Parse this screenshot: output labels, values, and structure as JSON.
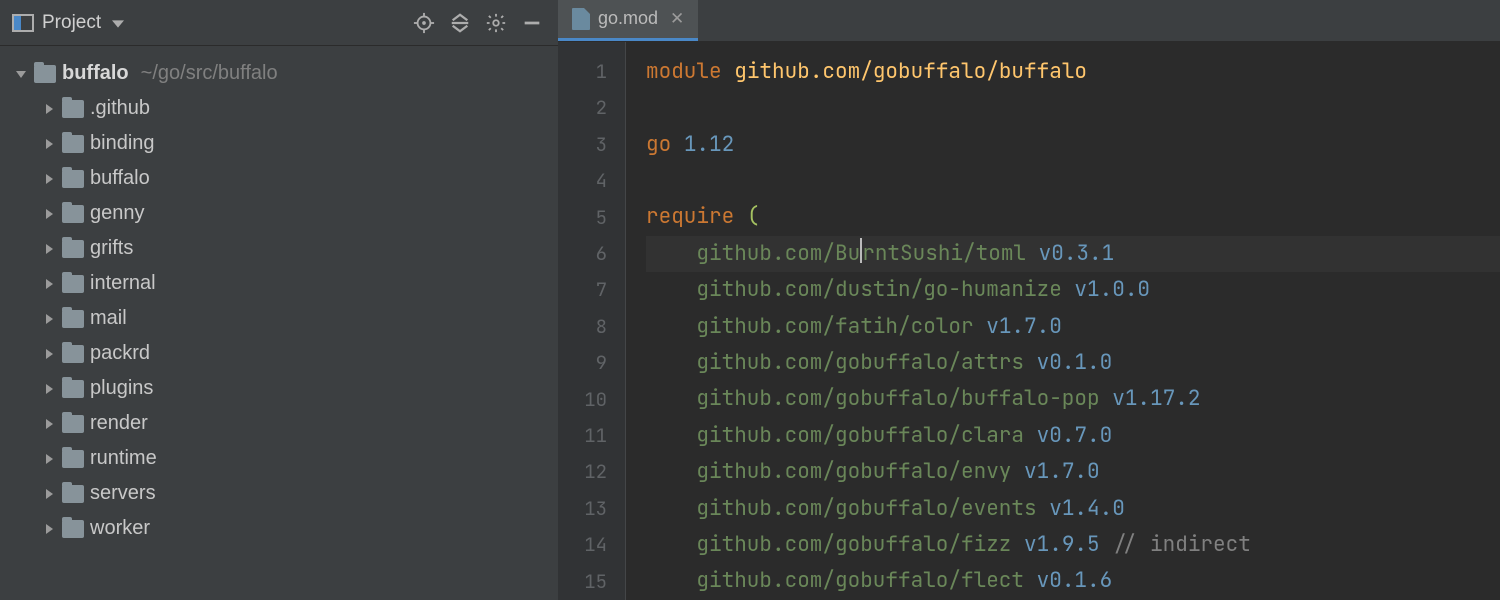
{
  "sidebar": {
    "panel_label": "Project",
    "root": {
      "name": "buffalo",
      "path": "~/go/src/buffalo"
    },
    "children": [
      {
        "name": ".github"
      },
      {
        "name": "binding"
      },
      {
        "name": "buffalo"
      },
      {
        "name": "genny"
      },
      {
        "name": "grifts"
      },
      {
        "name": "internal"
      },
      {
        "name": "mail"
      },
      {
        "name": "packrd"
      },
      {
        "name": "plugins"
      },
      {
        "name": "render"
      },
      {
        "name": "runtime"
      },
      {
        "name": "servers"
      },
      {
        "name": "worker"
      }
    ]
  },
  "tab": {
    "filename": "go.mod"
  },
  "editor": {
    "module_kw": "module",
    "module_path": "github.com/gobuffalo/buffalo",
    "go_kw": "go",
    "go_version": "1.12",
    "require_kw": "require",
    "require_paren": "(",
    "cursor_line": 6,
    "deps": [
      {
        "path": "github.com/BurntSushi/toml",
        "version": "v0.3.1",
        "comment": ""
      },
      {
        "path": "github.com/dustin/go-humanize",
        "version": "v1.0.0",
        "comment": ""
      },
      {
        "path": "github.com/fatih/color",
        "version": "v1.7.0",
        "comment": ""
      },
      {
        "path": "github.com/gobuffalo/attrs",
        "version": "v0.1.0",
        "comment": ""
      },
      {
        "path": "github.com/gobuffalo/buffalo-pop",
        "version": "v1.17.2",
        "comment": ""
      },
      {
        "path": "github.com/gobuffalo/clara",
        "version": "v0.7.0",
        "comment": ""
      },
      {
        "path": "github.com/gobuffalo/envy",
        "version": "v1.7.0",
        "comment": ""
      },
      {
        "path": "github.com/gobuffalo/events",
        "version": "v1.4.0",
        "comment": ""
      },
      {
        "path": "github.com/gobuffalo/fizz",
        "version": "v1.9.5",
        "comment": "// indirect"
      },
      {
        "path": "github.com/gobuffalo/flect",
        "version": "v0.1.6",
        "comment": ""
      }
    ]
  },
  "line_numbers": [
    1,
    2,
    3,
    4,
    5,
    6,
    7,
    8,
    9,
    10,
    11,
    12,
    13,
    14,
    15
  ]
}
